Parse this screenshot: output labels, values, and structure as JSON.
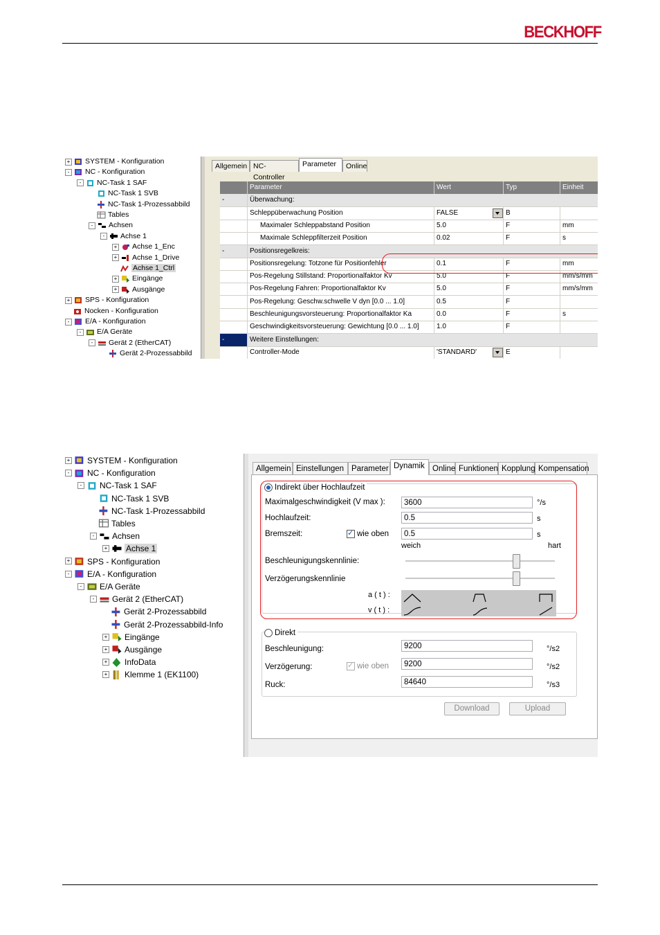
{
  "header": {
    "brand": "BECKHOFF",
    "brand_color": "#c8102e"
  },
  "screenshot1": {
    "tree": [
      {
        "label": "SYSTEM - Konfiguration",
        "level": 0,
        "expander": "+",
        "icon": "system-config-icon"
      },
      {
        "label": "NC - Konfiguration",
        "level": 0,
        "expander": "-",
        "icon": "nc-config-icon"
      },
      {
        "label": "NC-Task 1 SAF",
        "level": 1,
        "expander": "-",
        "icon": "task-icon"
      },
      {
        "label": "NC-Task 1 SVB",
        "level": 2,
        "expander": "",
        "icon": "task-icon"
      },
      {
        "label": "NC-Task 1-Prozessabbild",
        "level": 2,
        "expander": "",
        "icon": "process-image-icon"
      },
      {
        "label": "Tables",
        "level": 2,
        "expander": "",
        "icon": "table-icon"
      },
      {
        "label": "Achsen",
        "level": 2,
        "expander": "-",
        "icon": "axes-icon"
      },
      {
        "label": "Achse 1",
        "level": 3,
        "expander": "-",
        "icon": "axis-icon"
      },
      {
        "label": "Achse 1_Enc",
        "level": 4,
        "expander": "+",
        "icon": "encoder-icon"
      },
      {
        "label": "Achse 1_Drive",
        "level": 4,
        "expander": "+",
        "icon": "drive-icon"
      },
      {
        "label": "Achse 1_Ctrl",
        "level": 4,
        "expander": "",
        "icon": "controller-icon",
        "selected": true
      },
      {
        "label": "Eingänge",
        "level": 4,
        "expander": "+",
        "icon": "inputs-icon"
      },
      {
        "label": "Ausgänge",
        "level": 4,
        "expander": "+",
        "icon": "outputs-icon"
      },
      {
        "label": "SPS - Konfiguration",
        "level": 0,
        "expander": "+",
        "icon": "plc-config-icon"
      },
      {
        "label": "Nocken - Konfiguration",
        "level": 0,
        "expander": "",
        "icon": "cam-config-icon"
      },
      {
        "label": "E/A - Konfiguration",
        "level": 0,
        "expander": "-",
        "icon": "io-config-icon"
      },
      {
        "label": "E/A Geräte",
        "level": 1,
        "expander": "-",
        "icon": "io-devices-icon"
      },
      {
        "label": "Gerät 2 (EtherCAT)",
        "level": 2,
        "expander": "-",
        "icon": "ethercat-icon"
      },
      {
        "label": "Gerät 2-Prozessabbild",
        "level": 3,
        "expander": "",
        "icon": "process-image-icon"
      }
    ],
    "tabs": [
      "Allgemein",
      "NC-Controller",
      "Parameter",
      "Online"
    ],
    "active_tab": 2,
    "columns": [
      "Parameter",
      "Wert",
      "Typ",
      "Einheit"
    ],
    "rows": [
      {
        "kind": "section",
        "marker": "-",
        "param": "Überwachung:"
      },
      {
        "kind": "row",
        "param": "Schleppüberwachung Position",
        "value": "FALSE",
        "type": "B",
        "unit": "",
        "dropdown": true
      },
      {
        "kind": "row",
        "indent": true,
        "param": "Maximaler Schleppabstand Position",
        "value": "5.0",
        "type": "F",
        "unit": "mm"
      },
      {
        "kind": "row",
        "indent": true,
        "param": "Maximale Schleppfilterzeit Position",
        "value": "0.02",
        "type": "F",
        "unit": "s"
      },
      {
        "kind": "section",
        "marker": "-",
        "param": "Positionsregelkreis:"
      },
      {
        "kind": "row",
        "param": "Positionsregelung: Totzone für Positionfehler",
        "value": "0.1",
        "type": "F",
        "unit": "mm",
        "highlight": true
      },
      {
        "kind": "row",
        "param": "Pos-Regelung Stillstand: Proportionalfaktor Kv",
        "value": "5.0",
        "type": "F",
        "unit": "mm/s/mm"
      },
      {
        "kind": "row",
        "param": "Pos-Regelung Fahren: Proportionalfaktor Kv",
        "value": "5.0",
        "type": "F",
        "unit": "mm/s/mm"
      },
      {
        "kind": "row",
        "param": "Pos-Regelung: Geschw.schwelle V dyn [0.0 ... 1.0]",
        "value": "0.5",
        "type": "F",
        "unit": ""
      },
      {
        "kind": "row",
        "param": "Beschleunigungsvorsteuerung: Proportionalfaktor Ka",
        "value": "0.0",
        "type": "F",
        "unit": "s"
      },
      {
        "kind": "row",
        "param": "Geschwindigkeitsvorsteuerung: Gewichtung [0.0 ... 1.0]",
        "value": "1.0",
        "type": "F",
        "unit": ""
      },
      {
        "kind": "section",
        "marker": "-",
        "param": "Weitere Einstellungen:",
        "dark": true
      },
      {
        "kind": "row",
        "param": "Controller-Mode",
        "value": "'STANDARD'",
        "type": "E",
        "unit": "",
        "dropdown": true
      }
    ]
  },
  "screenshot2": {
    "tree": [
      {
        "label": "SYSTEM - Konfiguration",
        "level": 0,
        "expander": "+",
        "icon": "system-config-icon"
      },
      {
        "label": "NC - Konfiguration",
        "level": 0,
        "expander": "-",
        "icon": "nc-config-icon"
      },
      {
        "label": "NC-Task 1 SAF",
        "level": 1,
        "expander": "-",
        "icon": "task-icon"
      },
      {
        "label": "NC-Task 1 SVB",
        "level": 2,
        "expander": "",
        "icon": "task-icon"
      },
      {
        "label": "NC-Task 1-Prozessabbild",
        "level": 2,
        "expander": "",
        "icon": "process-image-icon"
      },
      {
        "label": "Tables",
        "level": 2,
        "expander": "",
        "icon": "table-icon"
      },
      {
        "label": "Achsen",
        "level": 2,
        "expander": "-",
        "icon": "axes-icon"
      },
      {
        "label": "Achse 1",
        "level": 3,
        "expander": "+",
        "icon": "axis-icon",
        "selected": true
      },
      {
        "label": "SPS - Konfiguration",
        "level": 0,
        "expander": "+",
        "icon": "plc-config-icon"
      },
      {
        "label": "E/A - Konfiguration",
        "level": 0,
        "expander": "-",
        "icon": "io-config-icon"
      },
      {
        "label": "E/A Geräte",
        "level": 1,
        "expander": "-",
        "icon": "io-devices-icon"
      },
      {
        "label": "Gerät 2 (EtherCAT)",
        "level": 2,
        "expander": "-",
        "icon": "ethercat-icon"
      },
      {
        "label": "Gerät 2-Prozessabbild",
        "level": 3,
        "expander": "",
        "icon": "process-image-icon"
      },
      {
        "label": "Gerät 2-Prozessabbild-Info",
        "level": 3,
        "expander": "",
        "icon": "process-image-icon"
      },
      {
        "label": "Eingänge",
        "level": 3,
        "expander": "+",
        "icon": "inputs-icon"
      },
      {
        "label": "Ausgänge",
        "level": 3,
        "expander": "+",
        "icon": "outputs-icon"
      },
      {
        "label": "InfoData",
        "level": 3,
        "expander": "+",
        "icon": "infodata-icon"
      },
      {
        "label": "Klemme 1 (EK1100)",
        "level": 3,
        "expander": "+",
        "icon": "terminal-icon"
      }
    ],
    "tabs": [
      "Allgemein",
      "Einstellungen",
      "Parameter",
      "Dynamik",
      "Online",
      "Funktionen",
      "Kopplung",
      "Kompensation"
    ],
    "active_tab": 3,
    "indirect": {
      "radio_label": "Indirekt über Hochlaufzeit",
      "vmax_label": "Maximalgeschwindigkeit (V max ):",
      "vmax_value": "3600",
      "vmax_unit": "°/s",
      "hochlauf_label": "Hochlaufzeit:",
      "hochlauf_value": "0.5",
      "hochlauf_unit": "s",
      "brems_label": "Bremszeit:",
      "brems_check_label": "wie oben",
      "brems_value": "0.5",
      "brems_unit": "s",
      "soft_label": "weich",
      "hard_label": "hart",
      "accel_curve_label": "Beschleunigungskennlinie:",
      "accel_slider": 0.74,
      "decel_curve_label": "Verzögerungskennlinie",
      "decel_slider": 0.74,
      "a_label": "a ( t ) :",
      "v_label": "v ( t ) :"
    },
    "direct": {
      "radio_label": "Direkt",
      "accel_label": "Beschleunigung:",
      "accel_value": "9200",
      "accel_unit": "°/s2",
      "decel_label": "Verzögerung:",
      "decel_check_label": "wie oben",
      "decel_value": "9200",
      "decel_unit": "°/s2",
      "jerk_label": "Ruck:",
      "jerk_value": "84640",
      "jerk_unit": "°/s3"
    },
    "buttons": {
      "download": "Download",
      "upload": "Upload"
    }
  }
}
